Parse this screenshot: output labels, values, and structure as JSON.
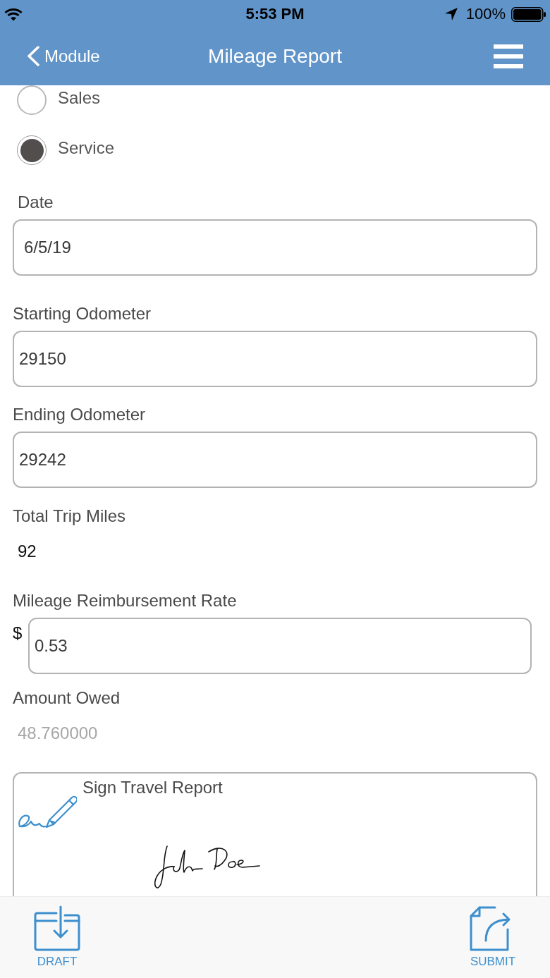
{
  "status_bar": {
    "time": "5:53 PM",
    "battery": "100%"
  },
  "nav": {
    "back": "Module",
    "title": "Mileage Report"
  },
  "trip_type": [
    {
      "label": "Sales",
      "selected": false
    },
    {
      "label": "Service",
      "selected": true
    }
  ],
  "fields": [
    {
      "kind": "date",
      "label": "Date",
      "value": "6/5/19"
    },
    {
      "kind": "input",
      "label": "Starting Odometer",
      "value": "29150"
    },
    {
      "kind": "input",
      "label": "Ending Odometer",
      "value": "29242"
    },
    {
      "kind": "readonly",
      "label": "Total Trip Miles",
      "value": "92"
    },
    {
      "kind": "currency",
      "label": "Mileage Reimbursement Rate",
      "prefix": "$",
      "value": "0.53"
    },
    {
      "kind": "computed",
      "label": "Amount Owed",
      "value": "48.760000"
    }
  ],
  "signature": {
    "label": "Sign Travel Report"
  },
  "toolbar": [
    {
      "kind": "draft",
      "label": "DRAFT"
    },
    {
      "kind": "submit",
      "label": "SUBMIT"
    }
  ]
}
